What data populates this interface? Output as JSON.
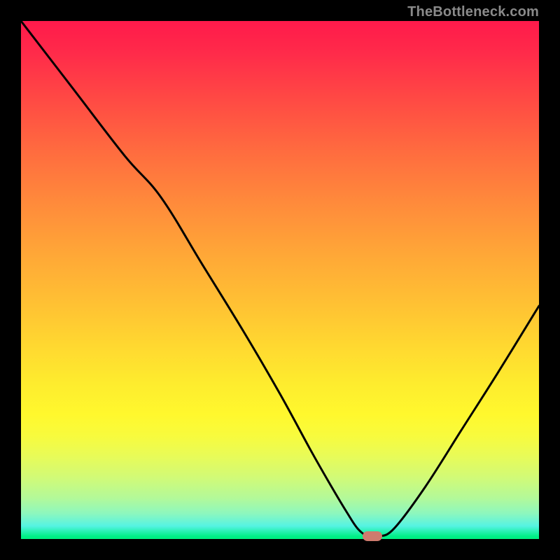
{
  "watermark": "TheBottleneck.com",
  "chart_data": {
    "type": "line",
    "title": "",
    "xlabel": "",
    "ylabel": "",
    "xlim": [
      0,
      100
    ],
    "ylim": [
      0,
      100
    ],
    "grid": false,
    "legend": null,
    "series": [
      {
        "name": "bottleneck-curve",
        "x": [
          0,
          10,
          20,
          27,
          35,
          43,
          50,
          56,
          60,
          63,
          65,
          67,
          69,
          72,
          78,
          85,
          92,
          100
        ],
        "y": [
          100,
          87,
          74,
          66,
          53,
          40,
          28,
          17,
          10,
          5,
          2,
          0.5,
          0.5,
          2,
          10,
          21,
          32,
          45
        ]
      }
    ],
    "marker": {
      "x": 67.8,
      "y": 0.6
    },
    "gradient_stops": [
      {
        "pos": 0.0,
        "color": "#ff1a4b"
      },
      {
        "pos": 0.5,
        "color": "#ffb935"
      },
      {
        "pos": 0.78,
        "color": "#fdfb31"
      },
      {
        "pos": 1.0,
        "color": "#00ee7f"
      }
    ]
  },
  "layout": {
    "image_size": 800,
    "plot_margin": 30,
    "plot_size": 740
  }
}
